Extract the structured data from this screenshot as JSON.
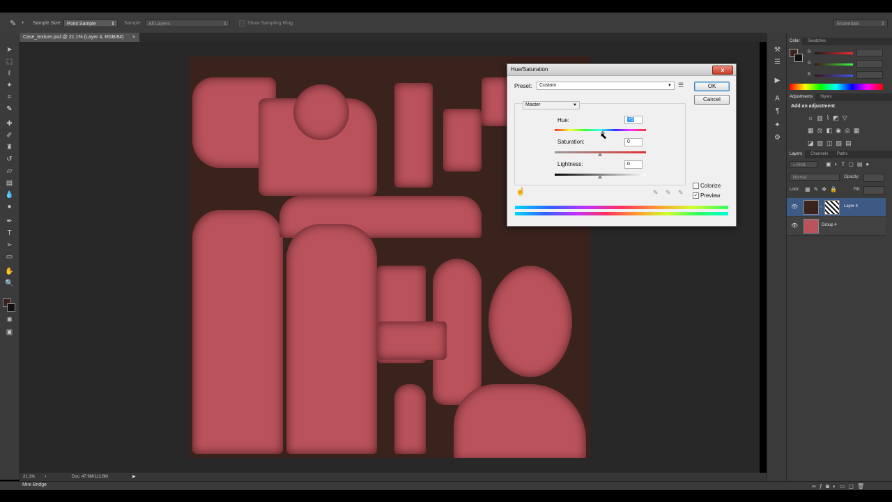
{
  "options_bar": {
    "sample_size_label": "Sample Size:",
    "sample_size_value": "Point Sample",
    "sample_label": "Sample:",
    "sample_value": "All Layers",
    "show_ring_label": "Show Sampling Ring",
    "workspace": "Essentials"
  },
  "document": {
    "tab_title": "Case_texture.psd @ 21.1% (Layer 4, RGB/8#)",
    "close_glyph": "×"
  },
  "status_bar": {
    "zoom": "21.1%",
    "doc_info": "Doc: 47.9M/112.8M"
  },
  "bottom_panel": {
    "label": "Mini Bridge"
  },
  "dialog": {
    "title": "Hue/Saturation",
    "preset_label": "Preset:",
    "preset_value": "Custom",
    "ok_label": "OK",
    "cancel_label": "Cancel",
    "channel_value": "Master",
    "hue_label": "Hue:",
    "hue_value": "+5",
    "saturation_label": "Saturation:",
    "saturation_value": "0",
    "lightness_label": "Lightness:",
    "lightness_value": "0",
    "colorize_label": "Colorize",
    "preview_label": "Preview",
    "preview_checked": "✓",
    "close_glyph": "x"
  },
  "color_panel": {
    "tabs": [
      "Color",
      "Swatches"
    ],
    "channels": [
      "R",
      "G",
      "B"
    ]
  },
  "adjustments_panel": {
    "tabs": [
      "Adjustments",
      "Styles"
    ],
    "heading": "Add an adjustment"
  },
  "layers_panel": {
    "tabs": [
      "Layers",
      "Channels",
      "Paths"
    ],
    "kind_filter": "Kind",
    "blend_mode": "Normal",
    "opacity_label": "Opacity:",
    "lock_label": "Lock:",
    "fill_label": "Fill:",
    "layers": [
      {
        "name": "Layer 4",
        "selected": true
      },
      {
        "name": "Group 4",
        "selected": false
      }
    ]
  },
  "colors": {
    "ui_dark": "#3c3c3c",
    "canvas_bg": "#282828",
    "texture_red": "#b9525b",
    "texture_dark": "#3a221d",
    "selection_blue": "#3d5a85"
  }
}
